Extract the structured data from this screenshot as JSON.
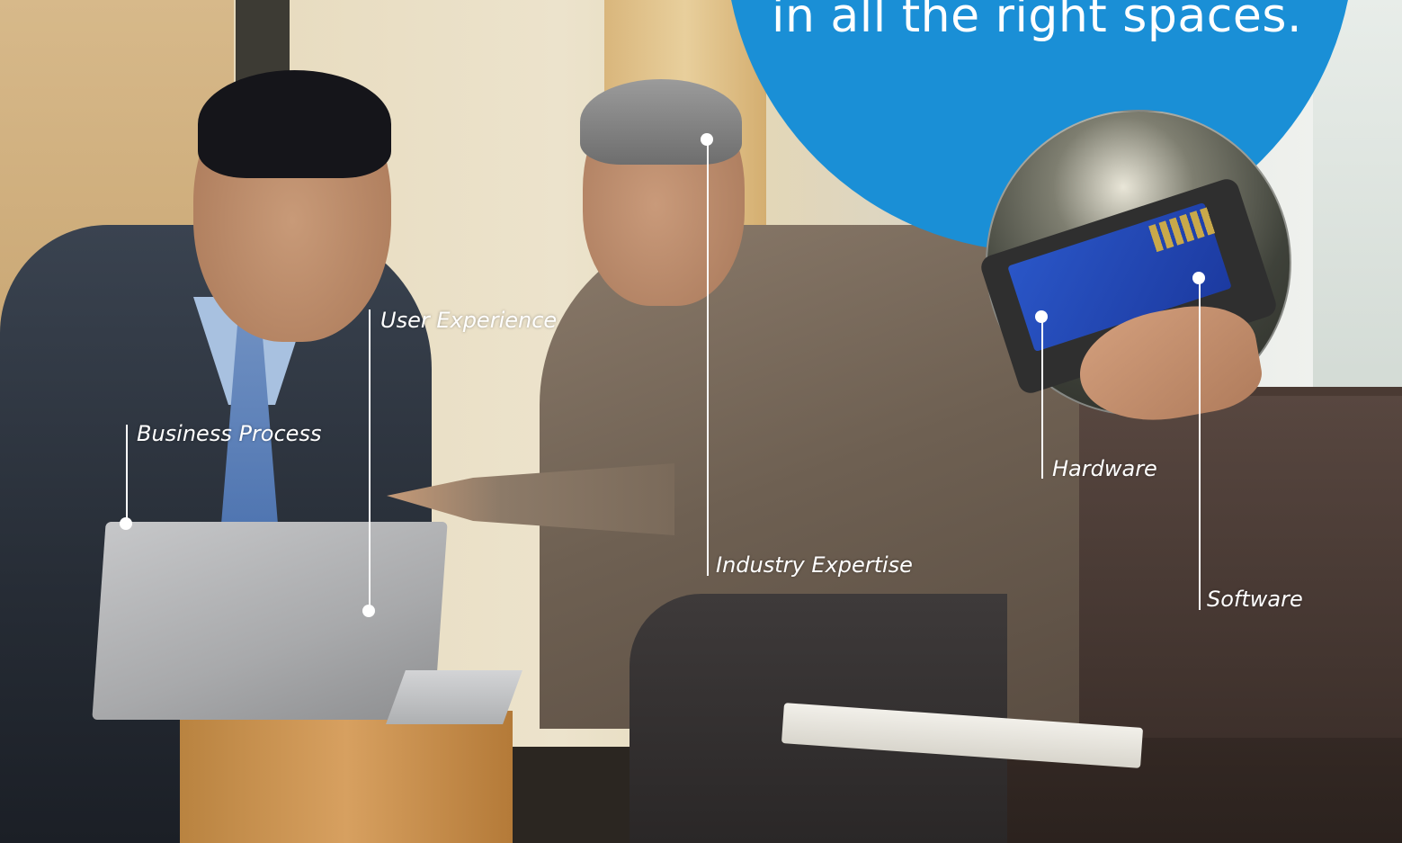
{
  "headline": "in all the right spaces.",
  "accent_color": "#1a8fd6",
  "callouts": {
    "business_process": "Business Process",
    "user_experience": "User Experience",
    "industry_expertise": "Industry Expertise",
    "hardware": "Hardware",
    "software": "Software"
  },
  "photo": {
    "main_scene": "two businessmen on a sofa reviewing a laptop",
    "inset_scene": "hand holding rugged tablet"
  }
}
